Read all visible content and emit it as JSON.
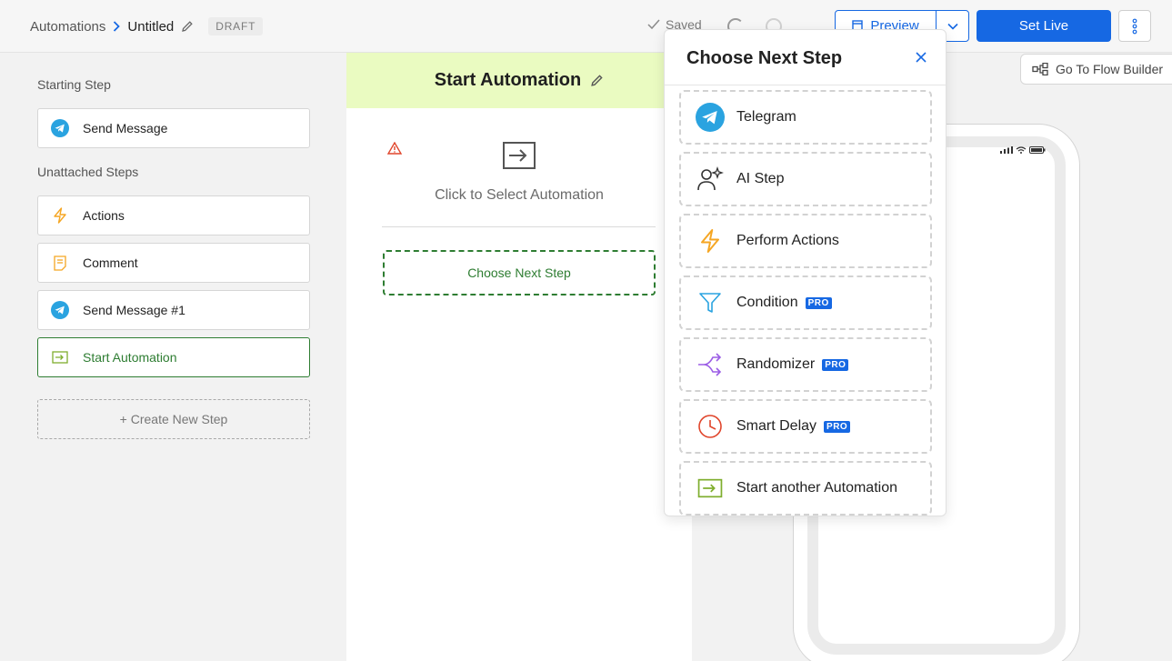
{
  "header": {
    "breadcrumb_root": "Automations",
    "breadcrumb_current": "Untitled",
    "status_badge": "DRAFT",
    "saved_label": "Saved",
    "preview_label": "Preview",
    "set_live_label": "Set Live"
  },
  "sidebar": {
    "starting_title": "Starting Step",
    "starting_steps": [
      {
        "label": "Send Message",
        "icon": "telegram-icon"
      }
    ],
    "unattached_title": "Unattached Steps",
    "unattached_steps": [
      {
        "label": "Actions",
        "icon": "lightning-icon"
      },
      {
        "label": "Comment",
        "icon": "note-icon"
      },
      {
        "label": "Send Message #1",
        "icon": "telegram-icon"
      },
      {
        "label": "Start Automation",
        "icon": "automation-icon",
        "active": true
      }
    ],
    "create_label": "+ Create New Step"
  },
  "editor": {
    "title": "Start Automation",
    "select_prompt": "Click to Select Automation",
    "next_step_label": "Choose Next Step"
  },
  "preview": {
    "flow_builder_label": "Go To Flow Builder"
  },
  "dropdown": {
    "title": "Choose Next Step",
    "options": [
      {
        "label": "Telegram",
        "icon": "telegram-icon",
        "pro": false
      },
      {
        "label": "AI Step",
        "icon": "ai-person-icon",
        "pro": false
      },
      {
        "label": "Perform Actions",
        "icon": "lightning-icon",
        "pro": false
      },
      {
        "label": "Condition",
        "icon": "filter-icon",
        "pro": true
      },
      {
        "label": "Randomizer",
        "icon": "randomizer-icon",
        "pro": true
      },
      {
        "label": "Smart Delay",
        "icon": "clock-icon",
        "pro": true
      },
      {
        "label": "Start another Automation",
        "icon": "automation-icon",
        "pro": false
      }
    ],
    "pro_label": "PRO"
  },
  "colors": {
    "accent_blue": "#1668e3",
    "active_green": "#2e7d32",
    "header_lime": "#eafbc1",
    "telegram_blue": "#2aa3e0",
    "lightning_orange": "#f5a623"
  }
}
